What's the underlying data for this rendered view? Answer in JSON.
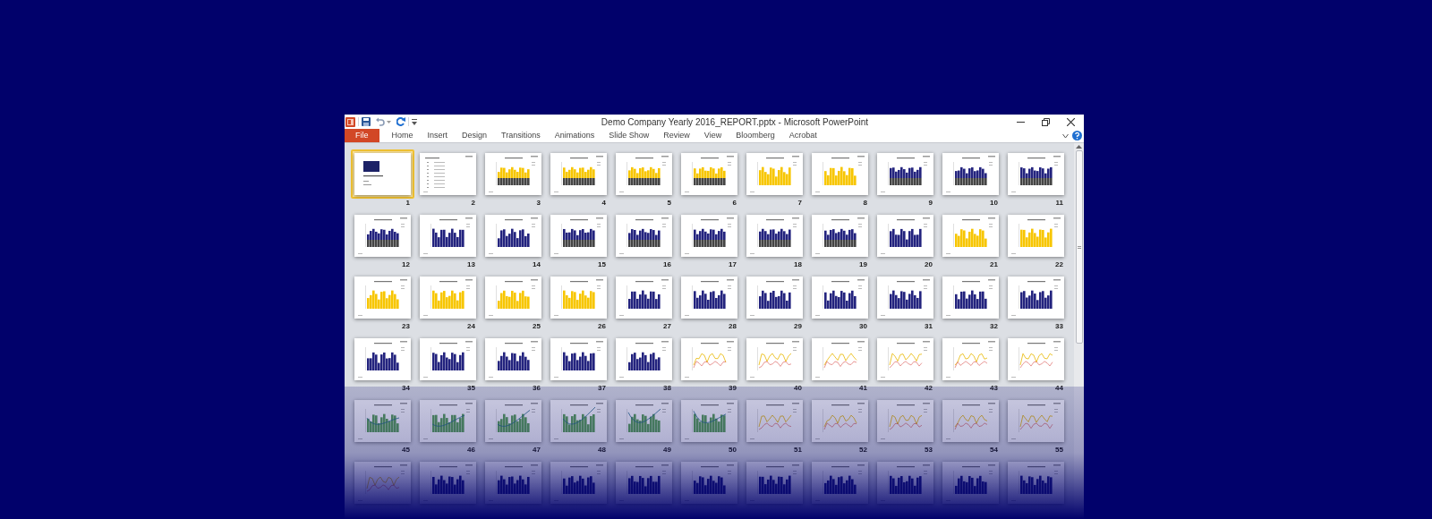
{
  "window": {
    "title": "Demo Company Yearly 2016_REPORT.pptx - Microsoft PowerPoint"
  },
  "ribbon_tabs": [
    {
      "label": "File",
      "kind": "file"
    },
    {
      "label": "Home",
      "kind": "tab"
    },
    {
      "label": "Insert",
      "kind": "tab"
    },
    {
      "label": "Design",
      "kind": "tab"
    },
    {
      "label": "Transitions",
      "kind": "tab"
    },
    {
      "label": "Animations",
      "kind": "tab"
    },
    {
      "label": "Slide Show",
      "kind": "tab"
    },
    {
      "label": "Review",
      "kind": "tab"
    },
    {
      "label": "View",
      "kind": "tab"
    },
    {
      "label": "Bloomberg",
      "kind": "tab"
    },
    {
      "label": "Acrobat",
      "kind": "tab"
    }
  ],
  "slides": [
    {
      "number": "1",
      "kind": "title",
      "selected": true
    },
    {
      "number": "2",
      "kind": "agenda",
      "selected": false
    },
    {
      "number": "3",
      "kind": "stacked-yellow",
      "selected": false
    },
    {
      "number": "4",
      "kind": "stacked-yellow",
      "selected": false
    },
    {
      "number": "5",
      "kind": "stacked-yellow",
      "selected": false
    },
    {
      "number": "6",
      "kind": "stacked-yellow",
      "selected": false
    },
    {
      "number": "7",
      "kind": "yellow",
      "selected": false
    },
    {
      "number": "8",
      "kind": "yellow",
      "selected": false
    },
    {
      "number": "9",
      "kind": "stacked-navy",
      "selected": false
    },
    {
      "number": "10",
      "kind": "stacked-navy",
      "selected": false
    },
    {
      "number": "11",
      "kind": "stacked-navy",
      "selected": false
    },
    {
      "number": "12",
      "kind": "stacked-navy",
      "selected": false
    },
    {
      "number": "13",
      "kind": "navy",
      "selected": false
    },
    {
      "number": "14",
      "kind": "navy",
      "selected": false
    },
    {
      "number": "15",
      "kind": "stacked-navy",
      "selected": false
    },
    {
      "number": "16",
      "kind": "stacked-navy",
      "selected": false
    },
    {
      "number": "17",
      "kind": "stacked-navy",
      "selected": false
    },
    {
      "number": "18",
      "kind": "stacked-navy",
      "selected": false
    },
    {
      "number": "19",
      "kind": "stacked-navy",
      "selected": false
    },
    {
      "number": "20",
      "kind": "navy",
      "selected": false
    },
    {
      "number": "21",
      "kind": "yellow",
      "selected": false
    },
    {
      "number": "22",
      "kind": "yellow",
      "selected": false
    },
    {
      "number": "23",
      "kind": "yellow",
      "selected": false
    },
    {
      "number": "24",
      "kind": "yellow",
      "selected": false
    },
    {
      "number": "25",
      "kind": "yellow",
      "selected": false
    },
    {
      "number": "26",
      "kind": "yellow",
      "selected": false
    },
    {
      "number": "27",
      "kind": "navy",
      "selected": false
    },
    {
      "number": "28",
      "kind": "navy",
      "selected": false
    },
    {
      "number": "29",
      "kind": "navy",
      "selected": false
    },
    {
      "number": "30",
      "kind": "navy",
      "selected": false
    },
    {
      "number": "31",
      "kind": "navy",
      "selected": false
    },
    {
      "number": "32",
      "kind": "navy",
      "selected": false
    },
    {
      "number": "33",
      "kind": "navy",
      "selected": false
    },
    {
      "number": "34",
      "kind": "navy",
      "selected": false
    },
    {
      "number": "35",
      "kind": "navy",
      "selected": false
    },
    {
      "number": "36",
      "kind": "navy",
      "selected": false
    },
    {
      "number": "37",
      "kind": "navy",
      "selected": false
    },
    {
      "number": "38",
      "kind": "navy",
      "selected": false
    },
    {
      "number": "39",
      "kind": "line",
      "selected": false
    },
    {
      "number": "40",
      "kind": "line",
      "selected": false
    },
    {
      "number": "41",
      "kind": "line",
      "selected": false
    },
    {
      "number": "42",
      "kind": "line",
      "selected": false
    },
    {
      "number": "43",
      "kind": "line",
      "selected": false
    },
    {
      "number": "44",
      "kind": "line",
      "selected": false
    },
    {
      "number": "45",
      "kind": "combo",
      "selected": false
    },
    {
      "number": "46",
      "kind": "combo",
      "selected": false
    },
    {
      "number": "47",
      "kind": "combo",
      "selected": false
    },
    {
      "number": "48",
      "kind": "combo",
      "selected": false
    },
    {
      "number": "49",
      "kind": "combo",
      "selected": false
    },
    {
      "number": "50",
      "kind": "combo",
      "selected": false
    },
    {
      "number": "51",
      "kind": "line",
      "selected": false
    },
    {
      "number": "52",
      "kind": "line",
      "selected": false
    },
    {
      "number": "53",
      "kind": "line",
      "selected": false
    },
    {
      "number": "54",
      "kind": "line",
      "selected": false
    },
    {
      "number": "55",
      "kind": "line",
      "selected": false
    }
  ],
  "slides_partial": [
    {
      "kind": "line"
    },
    {
      "kind": "navy"
    },
    {
      "kind": "navy"
    },
    {
      "kind": "navy"
    },
    {
      "kind": "navy"
    },
    {
      "kind": "navy"
    },
    {
      "kind": "navy"
    },
    {
      "kind": "navy"
    },
    {
      "kind": "navy"
    },
    {
      "kind": "navy"
    },
    {
      "kind": "navy"
    }
  ]
}
